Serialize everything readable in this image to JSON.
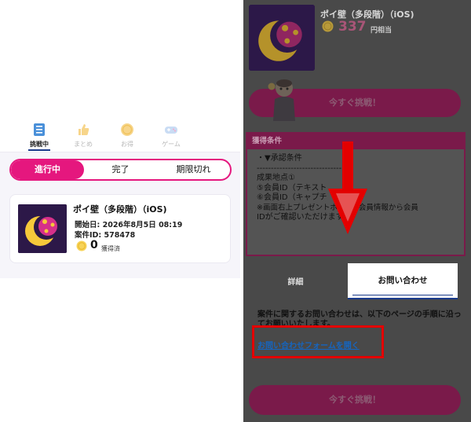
{
  "left": {
    "nav_tabs": [
      {
        "label": "挑戦中",
        "icon": "list-icon",
        "active": true
      },
      {
        "label": "まとめ",
        "icon": "thumbs-up-icon",
        "active": false
      },
      {
        "label": "お得",
        "icon": "coin-icon",
        "active": false
      },
      {
        "label": "ゲーム",
        "icon": "gamepad-icon",
        "active": false
      }
    ],
    "segments": [
      "進行中",
      "完了",
      "期限切れ"
    ],
    "card": {
      "title": "ポイ壁（多段階）（iOS)",
      "start": "開始日: 2026年8月5日 08:19",
      "case_id": "案件ID: 578478",
      "points": "0",
      "points_label": "獲得済"
    }
  },
  "right": {
    "title": "ポイ壁（多段階）（iOS)",
    "amount": "337",
    "unit": "円相当",
    "cta": "今すぐ挑戦！",
    "conditions_header": "獲得条件",
    "conditions_lines": [
      "・▼承認条件",
      "------------------------------",
      "成果地点①",
      "⑤会員ID（テキスト",
      "⑥会員ID（キャプチ",
      "※画面右上プレゼントボ―ク→会員情報から会員",
      "IDがご確認いただけます。"
    ],
    "tabs": [
      "詳細",
      "お問い合わせ"
    ],
    "inquiry_text": "案件に関するお問い合わせは、以下のページの手順に沿ってお願いいたします。",
    "inquiry_link": "お問い合わせフォームを開く",
    "cta_bottom": "今すぐ挑戦！",
    "colors": {
      "accent": "#e5177e",
      "highlight": "#e30000",
      "link": "#1565c0"
    }
  }
}
